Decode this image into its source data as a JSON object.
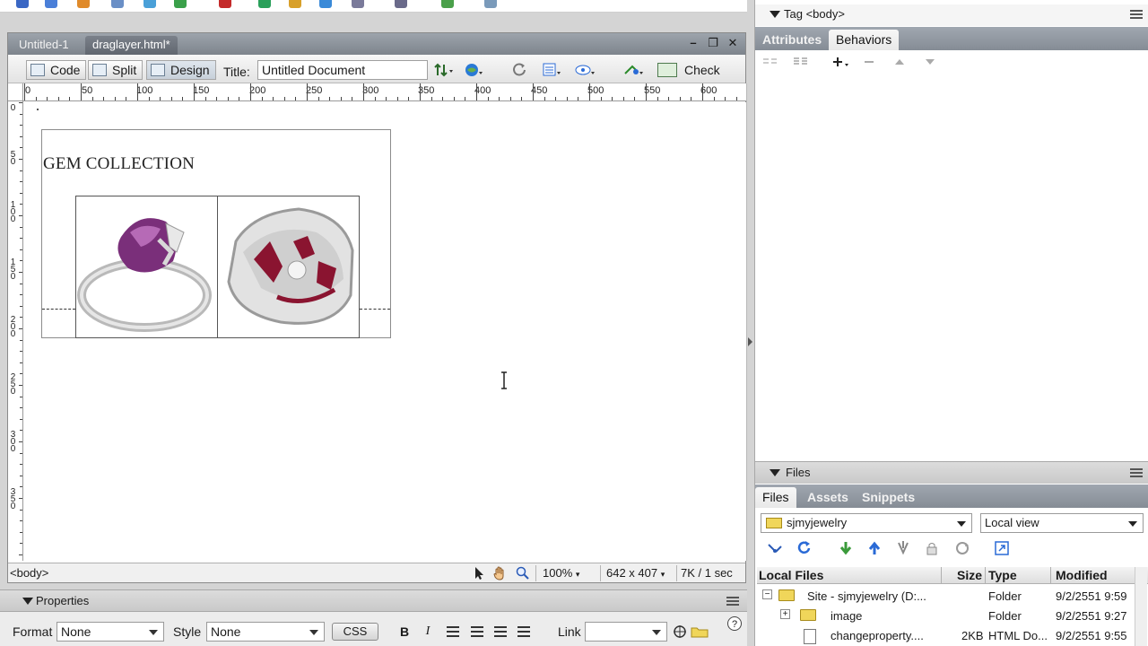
{
  "doc": {
    "tabs": [
      {
        "label": "Untitled-1",
        "active": false
      },
      {
        "label": "draglayer.html*",
        "active": true
      }
    ],
    "view_buttons": {
      "code": "Code",
      "split": "Split",
      "design": "Design"
    },
    "title_label": "Title:",
    "title_value": "Untitled Document",
    "check_page": "Check Page"
  },
  "ruler": {
    "h_labels": [
      "0",
      "50",
      "100",
      "150",
      "200",
      "250",
      "300",
      "350",
      "400",
      "450",
      "500",
      "550",
      "600"
    ],
    "v_labels": [
      "0",
      "50",
      "100",
      "150",
      "200",
      "250",
      "300",
      "350"
    ]
  },
  "canvas": {
    "heading": "GEM COLLECTION",
    "images": [
      {
        "name": "amethyst-ring-image",
        "stone_color": "#7a2f7a"
      },
      {
        "name": "ruby-ring-image",
        "stone_color": "#8a1430"
      }
    ]
  },
  "status": {
    "tag_selector": "<body>",
    "zoom": "100%",
    "window_size": "642 x 407",
    "download": "7K / 1 sec"
  },
  "properties": {
    "title": "Properties",
    "format_label": "Format",
    "format_value": "None",
    "style_label": "Style",
    "style_value": "None",
    "css_button": "CSS",
    "bold": "B",
    "italic": "I",
    "link_label": "Link",
    "link_value": ""
  },
  "tag_panel": {
    "title": "Tag <body>",
    "tabs": [
      "Attributes",
      "Behaviors"
    ],
    "active_tab": "Behaviors"
  },
  "files_panel": {
    "title": "Files",
    "tabs": [
      "Files",
      "Assets",
      "Snippets"
    ],
    "site": "sjmyjewelry",
    "view": "Local view",
    "columns": [
      "Local Files",
      "Size",
      "Type",
      "Modified"
    ],
    "rows": [
      {
        "name": "Site - sjmyjewelry (D:...",
        "size": "",
        "type": "Folder",
        "modified": "9/2/2551 9:59"
      },
      {
        "name": "image",
        "size": "",
        "type": "Folder",
        "modified": "9/2/2551 9:27"
      },
      {
        "name": "changeproperty....",
        "size": "2KB",
        "type": "HTML Do...",
        "modified": "9/2/2551 9:55"
      }
    ]
  },
  "colors": {
    "tab_bar": "#8a9199",
    "panel_bg": "#ececec",
    "accent_blue": "#2a6fd6",
    "folder_yellow": "#f0d65a"
  }
}
